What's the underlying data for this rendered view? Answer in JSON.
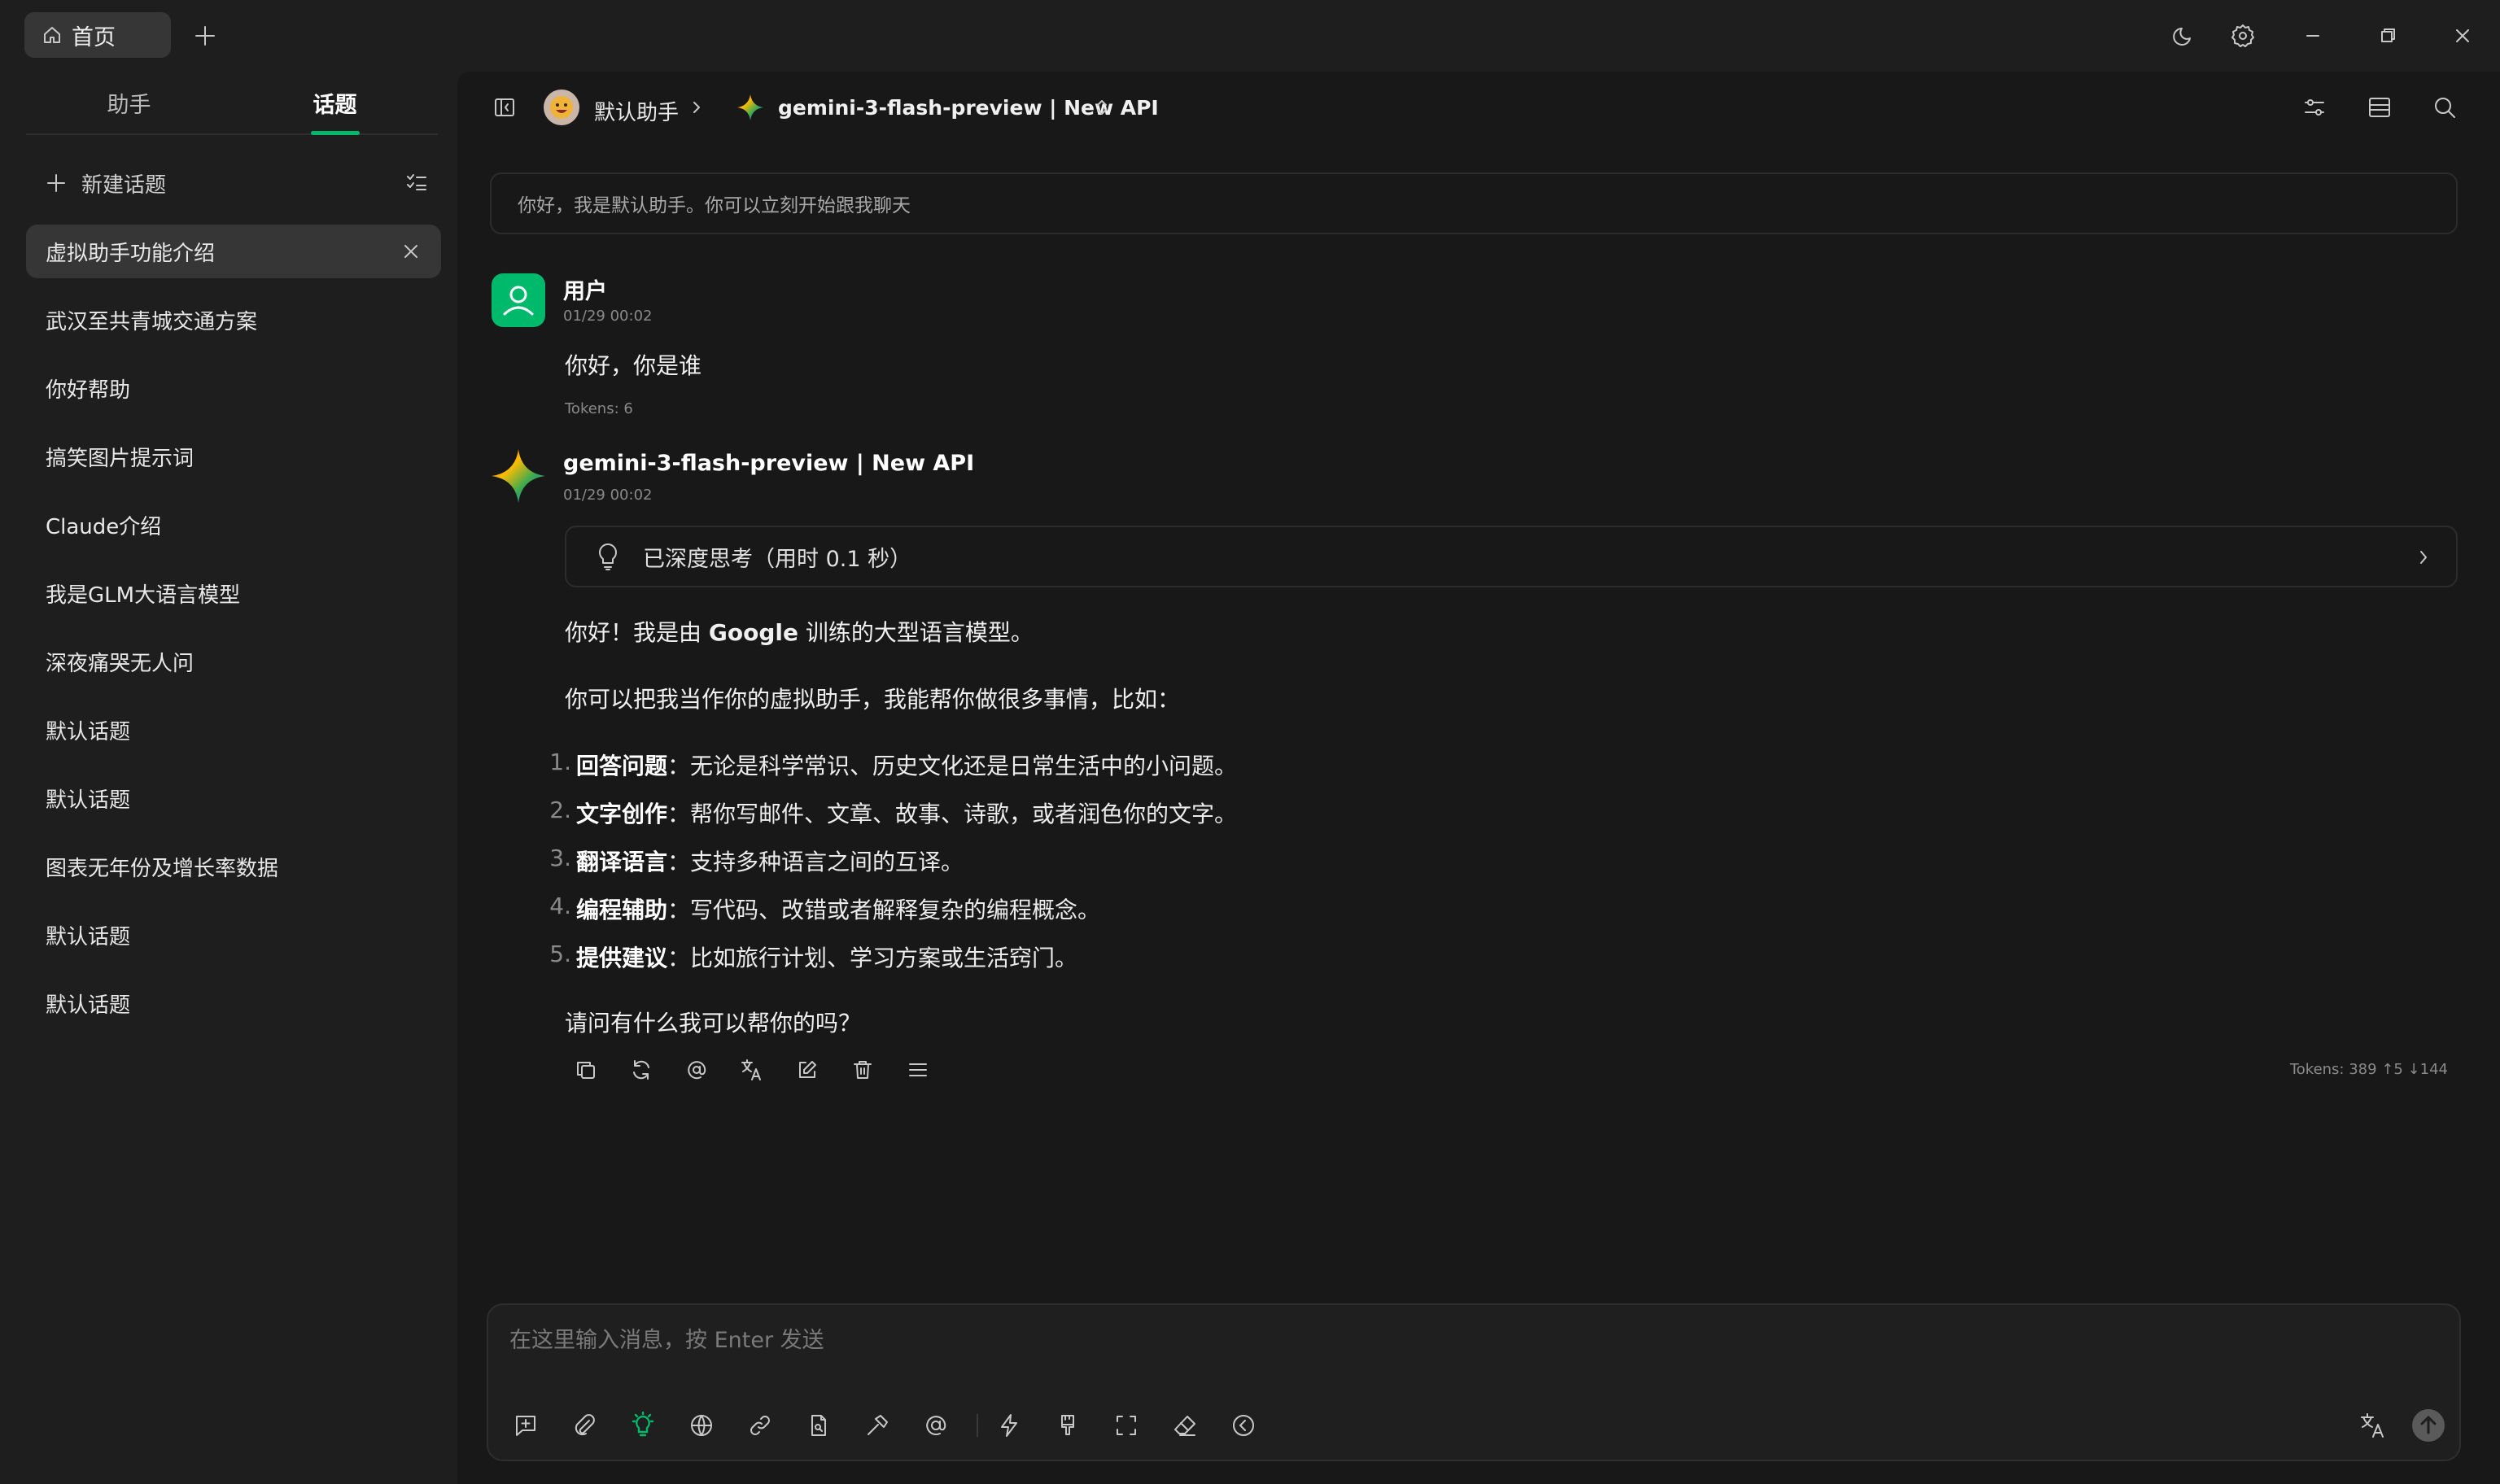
{
  "titlebar": {
    "home_tab": "首页"
  },
  "sidebar": {
    "tabs": [
      "助手",
      "话题"
    ],
    "new_topic": "新建话题",
    "topics": [
      "虚拟助手功能介绍",
      "武汉至共青城交通方案",
      "你好帮助",
      "搞笑图片提示词",
      "Claude介绍",
      "我是GLM大语言模型",
      "深夜痛哭无人问",
      "默认话题",
      "默认话题",
      "图表无年份及增长率数据",
      "默认话题",
      "默认话题"
    ]
  },
  "header": {
    "assistant": "默认助手",
    "model": "gemini-3-flash-preview | New API"
  },
  "welcome": "你好，我是默认助手。你可以立刻开始跟我聊天",
  "user_message": {
    "name": "用户",
    "time": "01/29 00:02",
    "text": "你好，你是谁",
    "tokens": "Tokens: 6"
  },
  "ai_message": {
    "name": "gemini-3-flash-preview | New API",
    "time": "01/29 00:02",
    "thinking": "已深度思考（用时 0.1 秒）",
    "para1_pre": "你好！我是由 ",
    "para1_bold": "Google",
    "para1_post": " 训练的大型语言模型。",
    "para2": "你可以把我当作你的虚拟助手，我能帮你做很多事情，比如：",
    "list": [
      {
        "num": "1.",
        "title": "回答问题",
        "text": "：无论是科学常识、历史文化还是日常生活中的小问题。"
      },
      {
        "num": "2.",
        "title": "文字创作",
        "text": "：帮你写邮件、文章、故事、诗歌，或者润色你的文字。"
      },
      {
        "num": "3.",
        "title": "翻译语言",
        "text": "：支持多种语言之间的互译。"
      },
      {
        "num": "4.",
        "title": "编程辅助",
        "text": "：写代码、改错或者解释复杂的编程概念。"
      },
      {
        "num": "5.",
        "title": "提供建议",
        "text": "：比如旅行计划、学习方案或生活窍门。"
      }
    ],
    "para3": "请问有什么我可以帮你的吗？",
    "tokens": "Tokens: 389 ↑5 ↓144"
  },
  "input": {
    "placeholder": "在这里输入消息，按 Enter 发送"
  },
  "colors": {
    "accent": "#00b96b",
    "background": "#181818",
    "sidebar": "#1e1e1e"
  }
}
